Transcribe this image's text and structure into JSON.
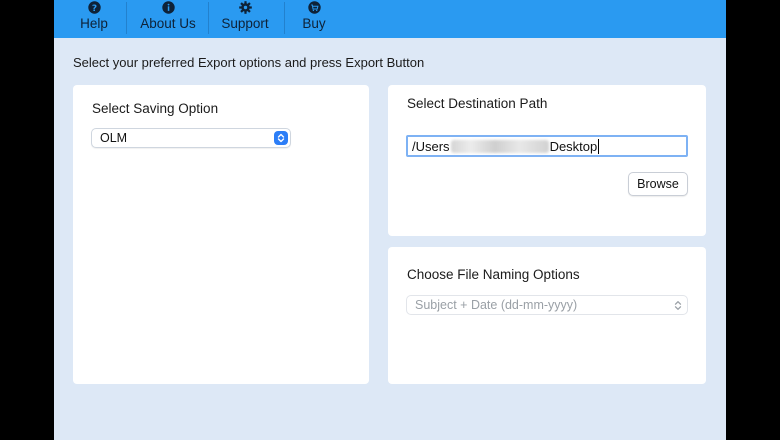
{
  "toolbar": {
    "items": [
      {
        "label": "Help",
        "icon": "question-circle-icon"
      },
      {
        "label": "About Us",
        "icon": "info-circle-icon"
      },
      {
        "label": "Support",
        "icon": "gear-icon"
      },
      {
        "label": "Buy",
        "icon": "cart-circle-icon"
      }
    ],
    "bg_color": "#2a9af1"
  },
  "instruction": "Select your preferred Export options and press Export Button",
  "saving": {
    "title": "Select Saving Option",
    "selected": "OLM"
  },
  "destination": {
    "title": "Select Destination Path",
    "path_prefix": "/Users",
    "path_suffix": "Desktop",
    "browse_label": "Browse"
  },
  "naming": {
    "title": "Choose File Naming Options",
    "selected": "Subject + Date (dd-mm-yyyy)"
  },
  "colors": {
    "window_bg": "#dde8f6",
    "accent": "#2c7ef7",
    "focus_ring": "#7eb2f4"
  }
}
